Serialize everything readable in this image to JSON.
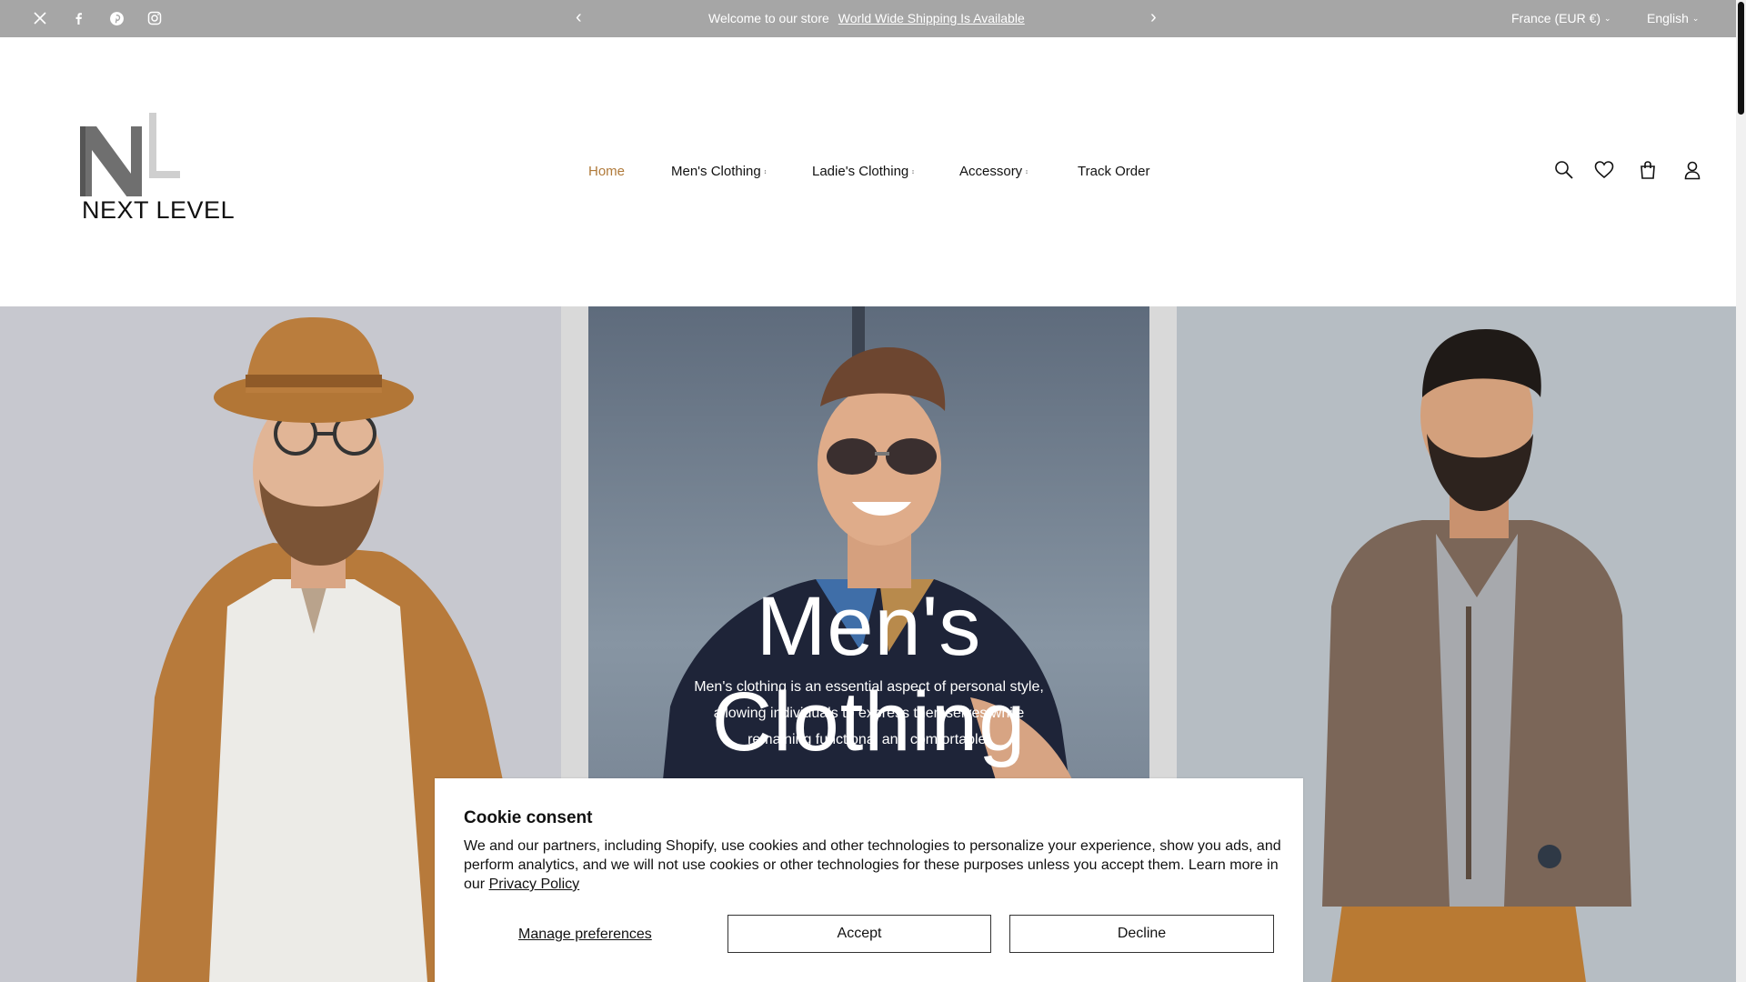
{
  "topbar": {
    "social_icons": [
      "x-icon",
      "facebook-icon",
      "pinterest-icon",
      "instagram-icon"
    ],
    "welcome_text": "Welcome to our store",
    "shipping_link": "World Wide Shipping Is Available",
    "country": "France (EUR €)",
    "language": "English",
    "bg_color": "#a6a6a6"
  },
  "header": {
    "logo_text": "NEXT LEVEL",
    "nav": [
      {
        "label": "Home",
        "active": true
      },
      {
        "label": "Men's Clothing",
        "dropdown": true
      },
      {
        "label": "Ladie's Clothing",
        "dropdown": true
      },
      {
        "label": "Accessory",
        "dropdown": true
      },
      {
        "label": "Track Order"
      }
    ],
    "icons": [
      "search-icon",
      "wishlist-icon",
      "cart-icon",
      "account-icon"
    ],
    "accent_color": "#b07a3a"
  },
  "hero": {
    "title": "Men's Clothing",
    "text_lines": [
      "Men's clothing is an essential aspect of personal style,",
      "allowing individuals to express themselves while",
      "remaining functional and comfortable."
    ]
  },
  "cookie": {
    "title": "Cookie consent",
    "body": "We and our partners, including Shopify, use cookies and other technologies to personalize your experience, show you ads, and perform analytics, and we will not use cookies or other technologies for these purposes unless you accept them. Learn more in our",
    "privacy_link": "Privacy Policy",
    "manage_label": "Manage preferences",
    "accept_label": "Accept",
    "decline_label": "Decline"
  }
}
